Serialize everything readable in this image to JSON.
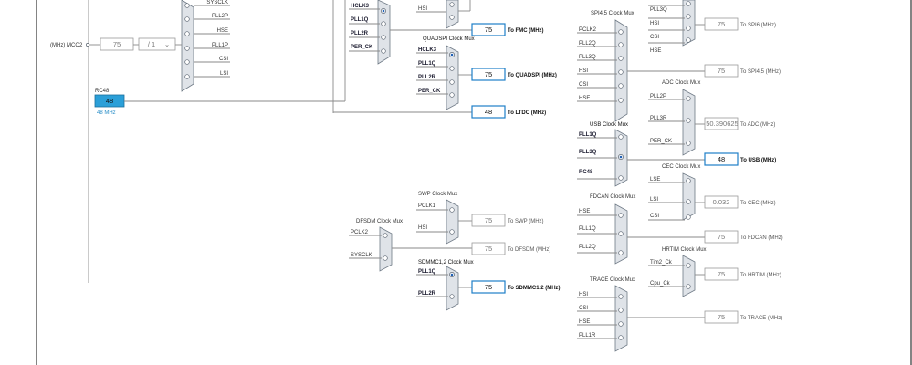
{
  "left_top": {
    "mux_inputs": [
      "SYSCLK",
      "PLL2P",
      "HSE",
      "PLL1P",
      "CSI",
      "LSI"
    ],
    "mco2_label": "(MHz) MCO2",
    "mco2_value": "75",
    "mco2_divider": "/ 1",
    "rc48_title": "RC48",
    "rc48_value": "48",
    "rc48_freq": "48 MHz"
  },
  "fmc": {
    "inputs": [
      "HCLK3",
      "PLL1Q",
      "PLL2R",
      "PER_CK"
    ],
    "value": "75",
    "out": "To FMC (MHz)"
  },
  "ltdc_top": {
    "inputs": [
      "HSI"
    ]
  },
  "quadspi": {
    "title": "QUADSPI Clock Mux",
    "inputs": [
      "HCLK3",
      "PLL1Q",
      "PLL2R",
      "PER_CK"
    ],
    "value": "75",
    "out": "To QUADSPI (MHz)"
  },
  "ltdc": {
    "value": "48",
    "out": "To LTDC (MHz)"
  },
  "spi45": {
    "title": "SPI4,5 Clock Mux",
    "inputs": [
      "PCLK2",
      "PLL2Q",
      "PLL3Q",
      "HSI",
      "CSI",
      "HSE"
    ],
    "value": "75",
    "out": "To SPI4,5 (MHz)"
  },
  "spi6": {
    "inputs": [
      "PLL3Q",
      "HSI",
      "CSI",
      "HSE"
    ],
    "value": "75",
    "out": "To SPI6 (MHz)"
  },
  "adc": {
    "title": "ADC Clock Mux",
    "inputs": [
      "PLL2P",
      "PLL3R",
      "PER_CK"
    ],
    "value": "50.390625",
    "out": "To ADC (MHz)"
  },
  "usb": {
    "title": "USB Clock Mux",
    "inputs": [
      "PLL1Q",
      "PLL3Q",
      "RC48"
    ],
    "value": "48",
    "out": "To USB (MHz)"
  },
  "cec": {
    "title": "CEC Clock Mux",
    "inputs": [
      "LSE",
      "LSI",
      "CSI"
    ],
    "value": "0.032",
    "out": "To CEC (MHz)"
  },
  "fdcan": {
    "title": "FDCAN Clock Mux",
    "inputs": [
      "HSE",
      "PLL1Q",
      "PLL2Q"
    ],
    "value": "75",
    "out": "To FDCAN (MHz)"
  },
  "hrtim": {
    "title": "HRTIM Clock Mux",
    "inputs": [
      "Tim2_Ck",
      "Cpu_Ck"
    ],
    "value": "75",
    "out": "To HRTIM (MHz)"
  },
  "trace": {
    "title": "TRACE Clock Mux",
    "inputs": [
      "HSI",
      "CSI",
      "HSE",
      "PLL1R"
    ],
    "value": "75",
    "out": "To TRACE (MHz)"
  },
  "swp": {
    "title": "SWP Clock Mux",
    "inputs": [
      "PCLK1",
      "HSI"
    ],
    "value": "75",
    "out": "To SWP (MHz)"
  },
  "dfsdm": {
    "title": "DFSDM Clock Mux",
    "inputs": [
      "PCLK2",
      "SYSCLK"
    ],
    "value": "75",
    "out": "To DFSDM (MHz)"
  },
  "sdmmc": {
    "title": "SDMMC1,2 Clock Mux",
    "inputs": [
      "PLL1Q",
      "PLL2R"
    ],
    "value": "75",
    "out": "To SDMMC1,2 (MHz)"
  }
}
